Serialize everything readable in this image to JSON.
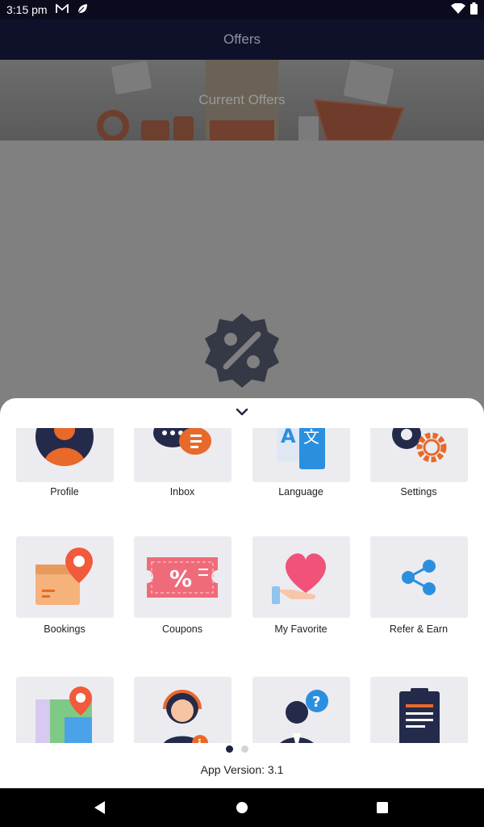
{
  "status": {
    "time": "3:15 pm",
    "icons": [
      "gmail-icon",
      "leaf-icon",
      "wifi-icon",
      "battery-icon"
    ]
  },
  "app_bar": {
    "title": "Offers"
  },
  "hero": {
    "title": "Current Offers"
  },
  "sheet": {
    "items": [
      {
        "label": "Profile",
        "icon": "profile-icon"
      },
      {
        "label": "Inbox",
        "icon": "inbox-icon"
      },
      {
        "label": "Language",
        "icon": "language-icon"
      },
      {
        "label": "Settings",
        "icon": "settings-icon"
      },
      {
        "label": "Bookings",
        "icon": "bookings-icon"
      },
      {
        "label": "Coupons",
        "icon": "coupons-icon"
      },
      {
        "label": "My Favorite",
        "icon": "favorite-icon"
      },
      {
        "label": "Refer & Earn",
        "icon": "share-icon"
      },
      {
        "label": "",
        "icon": "map-icon"
      },
      {
        "label": "",
        "icon": "support-icon"
      },
      {
        "label": "",
        "icon": "help-icon"
      },
      {
        "label": "",
        "icon": "document-icon"
      }
    ],
    "pagination": {
      "pages": 2,
      "current": 1
    },
    "app_version": "App Version: 3.1"
  },
  "colors": {
    "dark_navy": "#0e1129",
    "accent_orange": "#e8692a",
    "accent_blue": "#2b8fe0"
  }
}
